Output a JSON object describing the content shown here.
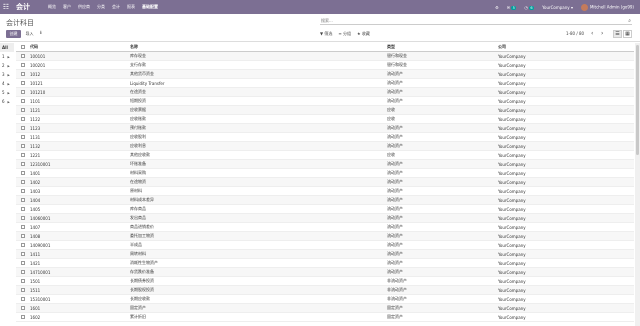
{
  "topbar": {
    "apps_icon": "grid-icon",
    "app_title": "会计",
    "menu": [
      "概览",
      "客户",
      "供应商",
      "分类",
      "会计",
      "报表",
      "基础配置"
    ],
    "chat_badge": "5",
    "activity_badge": "6",
    "company": "YourCompany",
    "user": "Mitchell Admin (go99)"
  },
  "control_panel": {
    "breadcrumb": "会计科目",
    "search_placeholder": "搜索...",
    "create_label": "创建",
    "import_label": "导入",
    "filter_label": "筛选",
    "group_label": "分组",
    "favorites_label": "收藏",
    "pager": "1-80 / 80"
  },
  "left_panel": {
    "items": [
      {
        "label": "All"
      },
      {
        "label": "1"
      },
      {
        "label": "2"
      },
      {
        "label": "3"
      },
      {
        "label": "4"
      },
      {
        "label": "5"
      },
      {
        "label": "6"
      }
    ]
  },
  "table": {
    "headers": [
      "代码",
      "名称",
      "类型",
      "公司"
    ],
    "rows": [
      [
        "100101",
        "库存现金",
        "银行和现金",
        "YourCompany"
      ],
      [
        "100201",
        "支行存款",
        "银行和现金",
        "YourCompany"
      ],
      [
        "1012",
        "其他货币资金",
        "流动资产",
        "YourCompany"
      ],
      [
        "10121",
        "Liquidity Transfer",
        "流动资产",
        "YourCompany"
      ],
      [
        "101210",
        "在途资金",
        "流动资产",
        "YourCompany"
      ],
      [
        "1101",
        "短期投资",
        "流动资产",
        "YourCompany"
      ],
      [
        "1121",
        "应收票据",
        "应收",
        "YourCompany"
      ],
      [
        "1122",
        "应收账款",
        "应收",
        "YourCompany"
      ],
      [
        "1123",
        "预付账款",
        "流动资产",
        "YourCompany"
      ],
      [
        "1131",
        "应收股利",
        "流动资产",
        "YourCompany"
      ],
      [
        "1132",
        "应收利息",
        "流动资产",
        "YourCompany"
      ],
      [
        "1221",
        "其他应收款",
        "应收",
        "YourCompany"
      ],
      [
        "12310001",
        "坏账准备",
        "流动资产",
        "YourCompany"
      ],
      [
        "1401",
        "材料采购",
        "流动资产",
        "YourCompany"
      ],
      [
        "1402",
        "在途物资",
        "流动资产",
        "YourCompany"
      ],
      [
        "1403",
        "原材料",
        "流动资产",
        "YourCompany"
      ],
      [
        "1404",
        "材料成本差异",
        "流动资产",
        "YourCompany"
      ],
      [
        "1405",
        "库存商品",
        "流动资产",
        "YourCompany"
      ],
      [
        "14060001",
        "发出商品",
        "流动资产",
        "YourCompany"
      ],
      [
        "1407",
        "商品进销差价",
        "流动资产",
        "YourCompany"
      ],
      [
        "1408",
        "委托加工物资",
        "流动资产",
        "YourCompany"
      ],
      [
        "14090001",
        "半成品",
        "流动资产",
        "YourCompany"
      ],
      [
        "1411",
        "周转材料",
        "流动资产",
        "YourCompany"
      ],
      [
        "1421",
        "消耗性生物资产",
        "流动资产",
        "YourCompany"
      ],
      [
        "14710001",
        "存货跌价准备",
        "流动资产",
        "YourCompany"
      ],
      [
        "1501",
        "长期债券投资",
        "非流动资产",
        "YourCompany"
      ],
      [
        "1511",
        "长期股权投资",
        "非流动资产",
        "YourCompany"
      ],
      [
        "15310001",
        "长期应收款",
        "非流动资产",
        "YourCompany"
      ],
      [
        "1601",
        "固定资产",
        "固定资产",
        "YourCompany"
      ],
      [
        "1602",
        "累计折旧",
        "固定资产",
        "YourCompany"
      ]
    ]
  }
}
